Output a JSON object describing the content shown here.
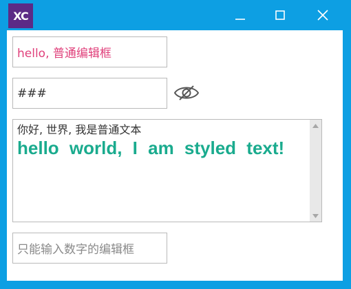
{
  "window": {
    "app_icon_text": "XC",
    "accent_color": "#0d9fe3",
    "icon_bg_color": "#5c2a86"
  },
  "edit_normal": {
    "value": "hello, 普通编辑框",
    "text_color": "#e0407b"
  },
  "edit_password": {
    "value": "###",
    "toggle_icon": "eye-off-icon"
  },
  "rich_text": {
    "plain_line": "你好, 世界, 我是普通文本",
    "styled_line": "hello world, I am styled text!",
    "styled_color": "#1aab8e"
  },
  "edit_numeric": {
    "placeholder": "只能输入数字的编辑框"
  }
}
